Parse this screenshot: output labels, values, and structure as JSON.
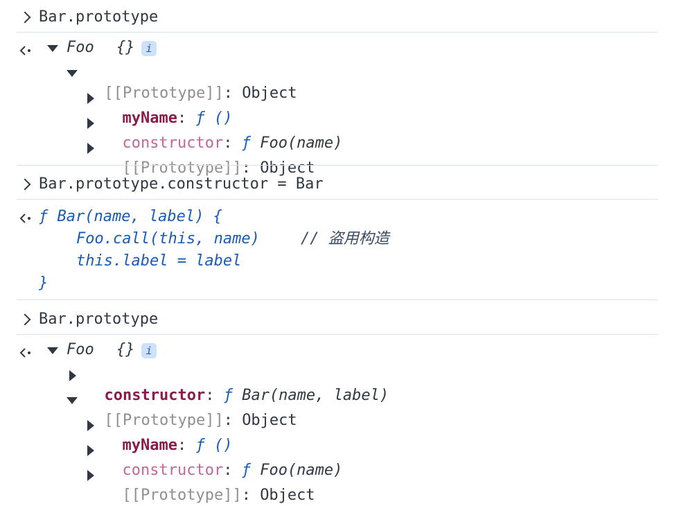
{
  "console": {
    "cmd1": "Bar.prototype",
    "out1": {
      "head_class": "Foo",
      "head_braces": "{}",
      "info_badge": "i",
      "proto_key": "[[Prototype]]",
      "proto_val": "Object",
      "myName_key": "myName",
      "myName_val": "ƒ ()",
      "ctor_key": "constructor",
      "ctor_f": "ƒ",
      "ctor_val": "Foo(name)",
      "proto2_key": "[[Prototype]]",
      "proto2_val": "Object"
    },
    "cmd2": "Bar.prototype.constructor = Bar",
    "out2": {
      "line1": "ƒ Bar(name, label) {",
      "line2": "Foo.call(this, name)",
      "line2_comment": "// 盗用构造",
      "line3": "this.label = label",
      "line4": "}"
    },
    "cmd3": "Bar.prototype",
    "out3": {
      "head_class": "Foo",
      "head_braces": "{}",
      "info_badge": "i",
      "ctor_key": "constructor",
      "ctor_f": "ƒ",
      "ctor_val": "Bar(name, label)",
      "proto_key": "[[Prototype]]",
      "proto_val": "Object",
      "myName_key": "myName",
      "myName_val": "ƒ ()",
      "ctor2_key": "constructor",
      "ctor2_f": "ƒ",
      "ctor2_val": "Foo(name)",
      "proto2_key": "[[Prototype]]",
      "proto2_val": "Object"
    }
  }
}
